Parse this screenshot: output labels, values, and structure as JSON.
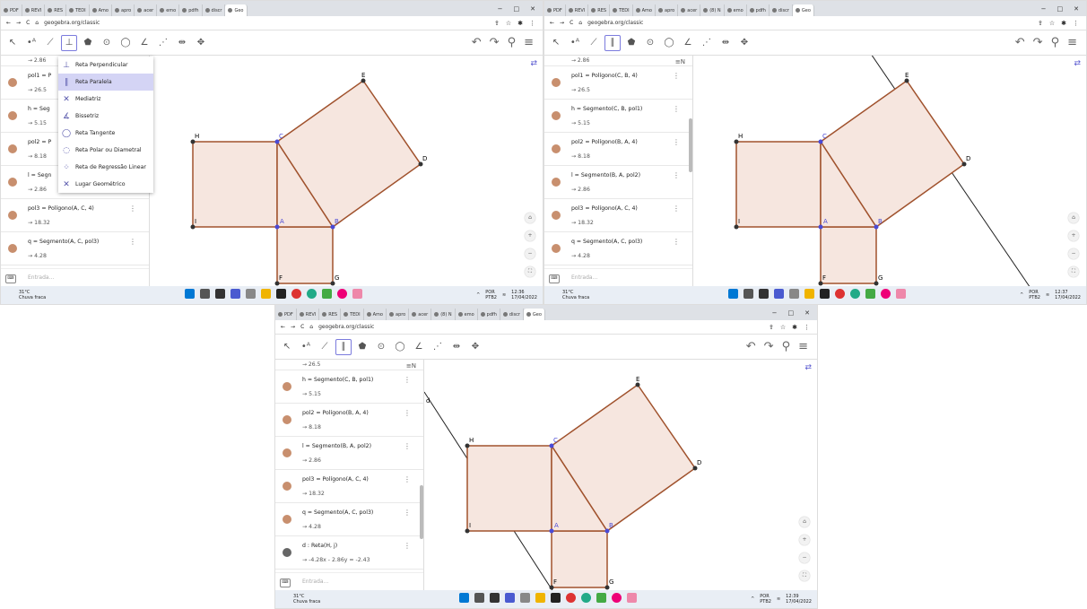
{
  "tabs": [
    "PDF",
    "REVI",
    "RES",
    "TEDI",
    "Amo",
    "apro",
    "acer",
    "(8) N",
    "emo",
    "pdfh",
    "discr",
    "Geo"
  ],
  "url": "geogebra.org/classic",
  "toolbar_icons": [
    "arrow-icon",
    "point-icon",
    "line-icon",
    "perpendicular-icon",
    "polygon-icon",
    "circle-icon",
    "circle-3pt-icon",
    "angle-icon",
    "reflect-icon",
    "slider-icon",
    "move-view-icon"
  ],
  "shot1": {
    "top_value": "→ 2.86",
    "rows": [
      {
        "def": "pol1 = P",
        "val": "→ 26.5"
      },
      {
        "def": "h = Seg",
        "val": "→ 5.15"
      },
      {
        "def": "pol2 = P",
        "val": "→ 8.18"
      },
      {
        "def": "l = Segn",
        "val": "→ 2.86"
      },
      {
        "def": "pol3 = Polígono(A, C, 4)",
        "val": "→ 18.32"
      },
      {
        "def": "q = Segmento(A, C, pol3)",
        "val": "→ 4.28"
      }
    ],
    "dropdown": [
      "Reta Perpendicular",
      "Reta Paralela",
      "Mediatriz",
      "Bissetriz",
      "Reta Tangente",
      "Reta Polar ou Diametral",
      "Reta de Regressão Linear",
      "Lugar Geométrico"
    ],
    "time": "12:36",
    "date": "17/04/2022"
  },
  "shot2": {
    "top_value": "→ 2.86",
    "rows": [
      {
        "def": "pol1 = Polígono(C, B, 4)",
        "val": "→ 26.5"
      },
      {
        "def": "h = Segmento(C, B, pol1)",
        "val": "→ 5.15"
      },
      {
        "def": "pol2 = Polígono(B, A, 4)",
        "val": "→ 8.18"
      },
      {
        "def": "l = Segmento(B, A, pol2)",
        "val": "→ 2.86"
      },
      {
        "def": "pol3 = Polígono(A, C, 4)",
        "val": "→ 18.32"
      },
      {
        "def": "q = Segmento(A, C, pol3)",
        "val": "→ 4.28"
      }
    ],
    "time": "12:37",
    "date": "17/04/2022"
  },
  "shot3": {
    "top_value": "→ 26.5",
    "rows": [
      {
        "def": "h = Segmento(C, B, pol1)",
        "val": "→ 5.15"
      },
      {
        "def": "pol2 = Polígono(B, A, 4)",
        "val": "→ 8.18"
      },
      {
        "def": "l = Segmento(B, A, pol2)",
        "val": "→ 2.86"
      },
      {
        "def": "pol3 = Polígono(A, C, 4)",
        "val": "→ 18.32"
      },
      {
        "def": "q = Segmento(A, C, pol3)",
        "val": "→ 4.28"
      },
      {
        "def": "d : Reta(H, j)",
        "val": "→ -4.28x - 2.86y = -2.43"
      }
    ],
    "time": "12:39",
    "date": "17/04/2022"
  },
  "entrada": "Entrada...",
  "weather_temp": "31°C",
  "weather_desc": "Chuva fraca",
  "lang": "POR",
  "lang2": "PTB2",
  "points": [
    "A",
    "B",
    "C",
    "D",
    "E",
    "F",
    "G",
    "H",
    "I",
    "d"
  ],
  "colors": {
    "polygon_fill": "#f6e6df",
    "polygon_stroke": "#a0522d",
    "point_blue": "#4a4ad6",
    "line": "#222222"
  }
}
